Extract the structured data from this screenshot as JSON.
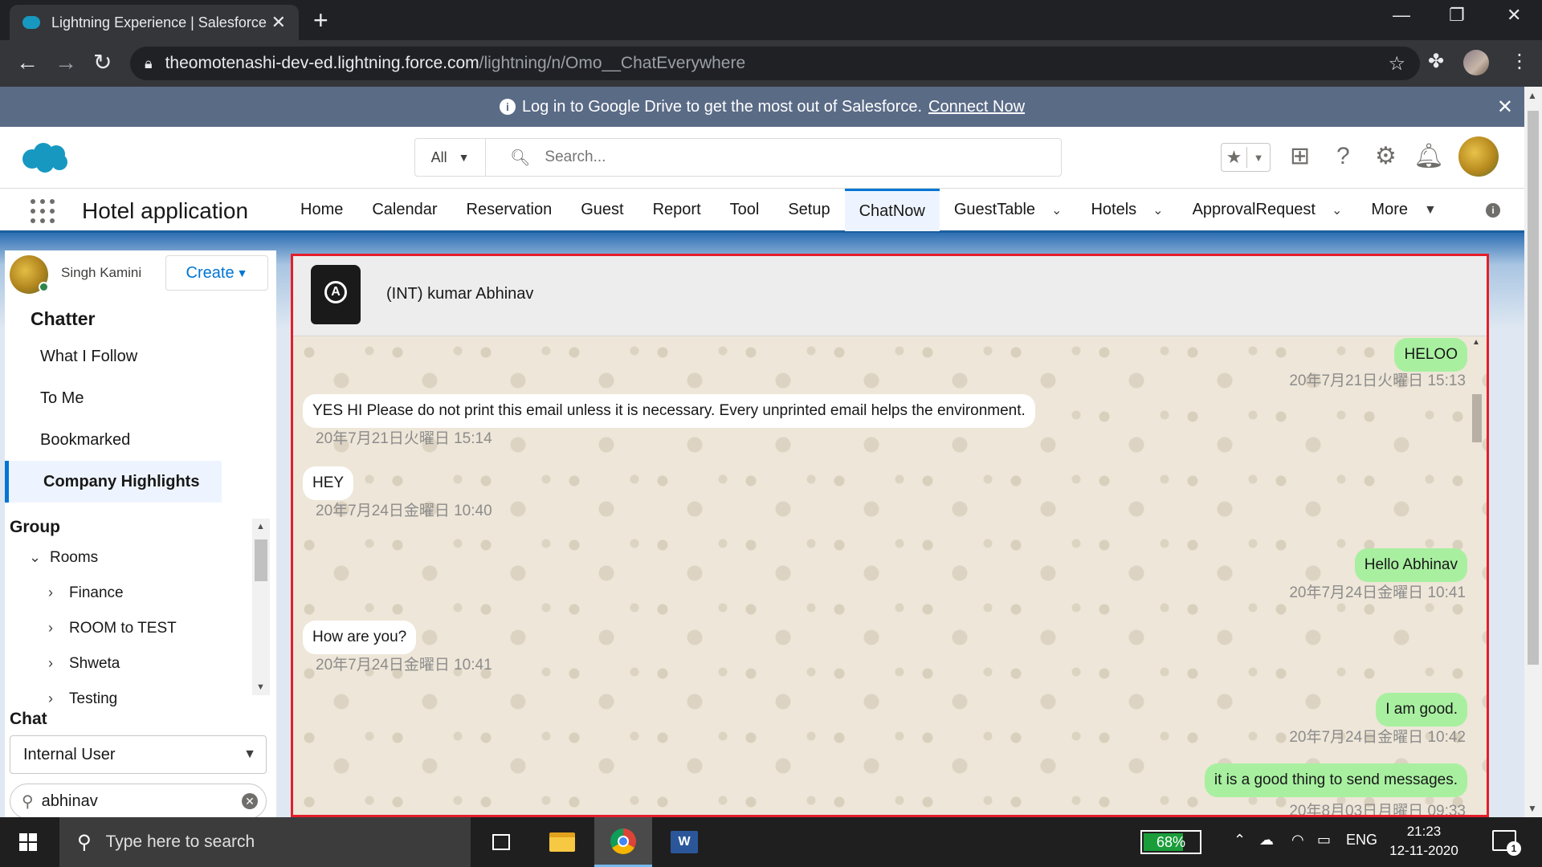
{
  "browser": {
    "tab_title": "Lightning Experience | Salesforce",
    "url_host": "theomotenashi-dev-ed.lightning.force.com",
    "url_path": "/lightning/n/Omo__ChatEverywhere"
  },
  "banner": {
    "text": "Log in to Google Drive to get the most out of Salesforce.",
    "link": "Connect Now"
  },
  "header": {
    "search_scope": "All",
    "search_placeholder": "Search..."
  },
  "appnav": {
    "app_name": "Hotel application",
    "items": [
      {
        "label": "Home"
      },
      {
        "label": "Calendar"
      },
      {
        "label": "Reservation"
      },
      {
        "label": "Guest"
      },
      {
        "label": "Report"
      },
      {
        "label": "Tool"
      },
      {
        "label": "Setup"
      },
      {
        "label": "ChatNow",
        "active": true
      },
      {
        "label": "GuestTable",
        "dropdown": true
      },
      {
        "label": "Hotels",
        "dropdown": true
      },
      {
        "label": "ApprovalRequest",
        "dropdown": true
      },
      {
        "label": "More",
        "dropdown": true
      }
    ]
  },
  "sidebar": {
    "user_name": "Singh Kamini",
    "create_label": "Create",
    "chatter_heading": "Chatter",
    "chatter_items": [
      "What I Follow",
      "To Me",
      "Bookmarked",
      "Company Highlights"
    ],
    "group_heading": "Group",
    "group_tree": {
      "root": "Rooms",
      "children": [
        "Finance",
        "ROOM to TEST",
        "Shweta",
        "Testing"
      ]
    },
    "chat_heading": "Chat",
    "chat_type": "Internal User",
    "chat_search_value": "abhinav"
  },
  "chat": {
    "contact_name": "(INT) kumar Abhinav",
    "messages": [
      {
        "dir": "out",
        "text": "HELOO",
        "time": "20年7月21日火曜日 15:13"
      },
      {
        "dir": "in",
        "text": "YES HI Please do not print this email unless it is necessary. Every unprinted email helps the environment.",
        "time": "20年7月21日火曜日 15:14"
      },
      {
        "dir": "in",
        "text": "HEY",
        "time": "20年7月24日金曜日 10:40"
      },
      {
        "dir": "out",
        "text": "Hello Abhinav",
        "time": "20年7月24日金曜日 10:41"
      },
      {
        "dir": "in",
        "text": "How are you?",
        "time": "20年7月24日金曜日 10:41"
      },
      {
        "dir": "out",
        "text": "I am good.",
        "time": "20年7月24日金曜日 10:42"
      },
      {
        "dir": "out",
        "text": "it is a good thing to send messages.",
        "time": "20年8月03日月曜日 09:33"
      }
    ]
  },
  "taskbar": {
    "search_placeholder": "Type here to search",
    "battery": "68%",
    "language": "ENG",
    "time": "21:23",
    "date": "12-11-2020",
    "notifications": "1"
  },
  "colors": {
    "sf_blue": "#0176d3",
    "banner": "#5a6b86",
    "outgoing_bubble": "#a8f0a0",
    "highlight_border": "#e41e2b"
  }
}
